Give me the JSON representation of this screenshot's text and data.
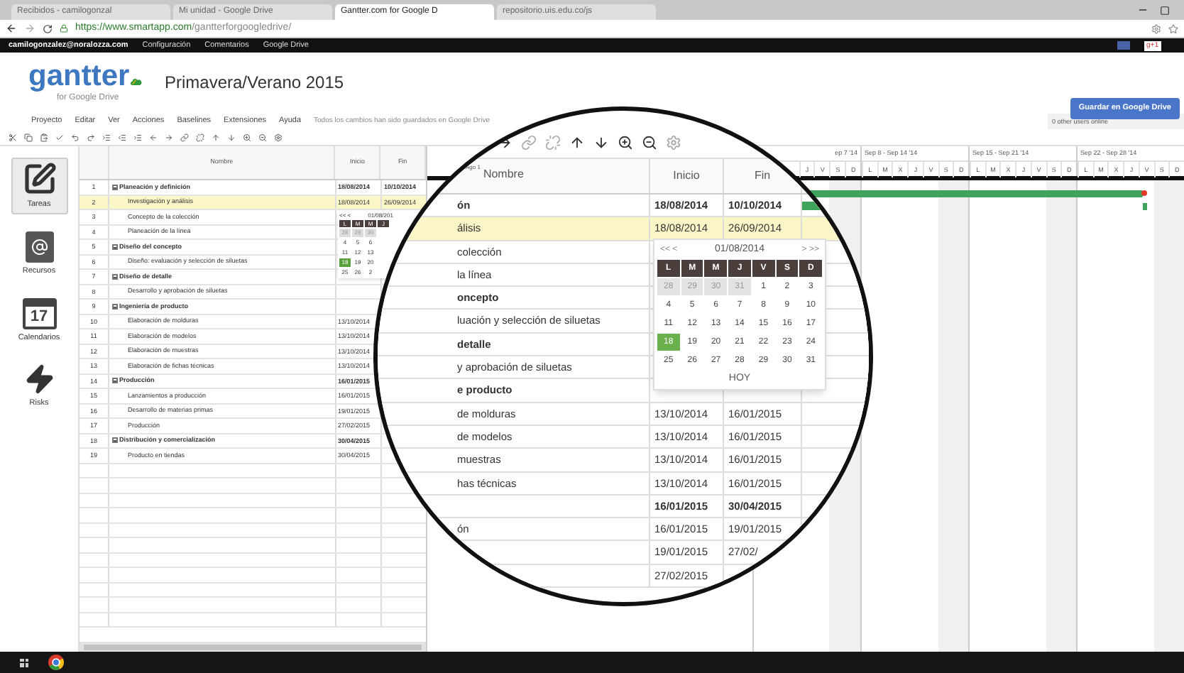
{
  "browser": {
    "tabs": [
      {
        "label": "Recibidos - camilogonzal",
        "selected": false
      },
      {
        "label": "Mi unidad - Google Drive",
        "selected": false
      },
      {
        "label": "Gantter.com for Google D",
        "selected": true
      },
      {
        "label": "repositorio.uis.edu.co/js",
        "selected": false
      }
    ],
    "url_host": "https://www.smartapp.com",
    "url_path": "/gantterforgoogledrive/"
  },
  "account_bar": {
    "email": "camilogonzalez@noralozza.com",
    "links": [
      "Configuración",
      "Comentarios",
      "Google Drive"
    ],
    "gplus": "g+1"
  },
  "app": {
    "logo": "gantter",
    "logo_sub": "for Google Drive",
    "title": "Primavera/Verano 2015",
    "save_button": "Guardar en Google Drive",
    "users_online": "0 other users online"
  },
  "menu": [
    "Proyecto",
    "Editar",
    "Ver",
    "Acciones",
    "Baselines",
    "Extensiones",
    "Ayuda"
  ],
  "status": "Todos los cambios han sido guardados en Google Drive",
  "sidebar": [
    {
      "label": "Tareas",
      "kind": "tasks",
      "selected": true
    },
    {
      "label": "Recursos",
      "kind": "resources",
      "selected": false
    },
    {
      "label": "Calendarios",
      "kind": "calendar",
      "badge": "17",
      "selected": false
    },
    {
      "label": "Risks",
      "kind": "risks",
      "selected": false
    }
  ],
  "table": {
    "columns": [
      "Nombre",
      "Inicio",
      "Fin"
    ],
    "rows": [
      {
        "num": "1",
        "name": "Planeación y definición",
        "kind": "group",
        "selected": false,
        "start": "18/08/2014",
        "end": "10/10/2014"
      },
      {
        "num": "2",
        "name": "Investigación y análisis",
        "kind": "task",
        "selected": true,
        "start": "18/08/2014",
        "end": "26/09/2014"
      },
      {
        "num": "3",
        "name": "Concepto de la colección",
        "kind": "task",
        "selected": false
      },
      {
        "num": "4",
        "name": "Planeación de la línea",
        "kind": "task",
        "selected": false
      },
      {
        "num": "5",
        "name": "Diseño del concepto",
        "kind": "group",
        "selected": false
      },
      {
        "num": "6",
        "name": "Diseño: evaluación y selección de siluetas",
        "kind": "task",
        "selected": false
      },
      {
        "num": "7",
        "name": "Diseño de detalle",
        "kind": "group",
        "selected": false
      },
      {
        "num": "8",
        "name": "Desarrollo y aprobación de siluetas",
        "kind": "task",
        "selected": false
      },
      {
        "num": "9",
        "name": "Ingeniería de producto",
        "kind": "group",
        "selected": false
      },
      {
        "num": "10",
        "name": "Elaboración de molduras",
        "kind": "task",
        "selected": false,
        "start": "13/10/2014"
      },
      {
        "num": "11",
        "name": "Elaboración de modelos",
        "kind": "task",
        "selected": false,
        "start": "13/10/2014"
      },
      {
        "num": "12",
        "name": "Elaboración de muestras",
        "kind": "task",
        "selected": false,
        "start": "13/10/2014"
      },
      {
        "num": "13",
        "name": "Elaboración de fichas técnicas",
        "kind": "task",
        "selected": false,
        "start": "13/10/2014"
      },
      {
        "num": "14",
        "name": "Producción",
        "kind": "group",
        "selected": false,
        "start": "16/01/2015"
      },
      {
        "num": "15",
        "name": "Lanzamientos a producción",
        "kind": "task",
        "selected": false,
        "start": "16/01/2015"
      },
      {
        "num": "16",
        "name": "Desarrollo de materias primas",
        "kind": "task",
        "selected": false,
        "start": "19/01/2015"
      },
      {
        "num": "17",
        "name": "Producción",
        "kind": "task",
        "selected": false,
        "start": "27/02/2015"
      },
      {
        "num": "18",
        "name": "Distribución y comercialización",
        "kind": "group",
        "selected": false,
        "start": "30/04/2015"
      },
      {
        "num": "19",
        "name": "Producto en tiendas",
        "kind": "task",
        "selected": false,
        "start": "30/04/2015"
      }
    ]
  },
  "mini_calendar": {
    "nav": "<< <",
    "month": "01/08/201",
    "weekdays": [
      "L",
      "M",
      "M",
      "J"
    ],
    "weeks": [
      [
        {
          "day": "28",
          "outside": true,
          "selected": false
        },
        {
          "day": "29",
          "outside": true,
          "selected": false
        },
        {
          "day": "30",
          "outside": true,
          "selected": false
        }
      ],
      [
        {
          "day": "4",
          "outside": false,
          "selected": false
        },
        {
          "day": "5",
          "outside": false,
          "selected": false
        },
        {
          "day": "6",
          "outside": false,
          "selected": false
        }
      ],
      [
        {
          "day": "11",
          "outside": false,
          "selected": false
        },
        {
          "day": "12",
          "outside": false,
          "selected": false
        },
        {
          "day": "13",
          "outside": false,
          "selected": false
        }
      ],
      [
        {
          "day": "18",
          "outside": false,
          "selected": true
        },
        {
          "day": "19",
          "outside": false,
          "selected": false
        },
        {
          "day": "20",
          "outside": false,
          "selected": false
        }
      ],
      [
        {
          "day": "25",
          "outside": false,
          "selected": false
        },
        {
          "day": "26",
          "outside": false,
          "selected": false
        },
        {
          "day": "2",
          "outside": false,
          "selected": false
        }
      ]
    ]
  },
  "gantt": {
    "weeks": [
      {
        "label": "ep 7 '14",
        "days": [
          "J",
          "V",
          "S",
          "D"
        ]
      },
      {
        "label": "Sep 8 - Sep 14 '14",
        "days": [
          "L",
          "M",
          "X",
          "J",
          "V",
          "S",
          "D"
        ]
      },
      {
        "label": "Sep 15 - Sep 21 '14",
        "days": [
          "L",
          "M",
          "X",
          "J",
          "V",
          "S",
          "D"
        ]
      },
      {
        "label": "Sep 22 - Sep 28 '14",
        "days": [
          "L",
          "M",
          "X",
          "J",
          "V",
          "S",
          "D"
        ]
      }
    ]
  },
  "magnifier": {
    "header_note": "Ago 1",
    "columns": [
      "Nombre",
      "Inicio",
      "Fin"
    ],
    "rows": [
      {
        "name": "ón",
        "kind": "group",
        "selected": false,
        "start": "18/08/2014",
        "end": "10/10/2014"
      },
      {
        "name": "álisis",
        "kind": "task",
        "selected": true,
        "start": "18/08/2014",
        "end": "26/09/2014"
      },
      {
        "name": "colección",
        "kind": "task",
        "selected": false
      },
      {
        "name": "la línea",
        "kind": "task",
        "selected": false
      },
      {
        "name": "oncepto",
        "kind": "group",
        "selected": false
      },
      {
        "name": "luación y selección de siluetas",
        "kind": "task",
        "selected": false
      },
      {
        "name": "detalle",
        "kind": "group",
        "selected": false
      },
      {
        "name": "y aprobación de siluetas",
        "kind": "task",
        "selected": false
      },
      {
        "name": "e producto",
        "kind": "group",
        "selected": false
      },
      {
        "name": "de molduras",
        "kind": "task",
        "selected": false,
        "start": "13/10/2014",
        "end": "16/01/2015"
      },
      {
        "name": "de modelos",
        "kind": "task",
        "selected": false,
        "start": "13/10/2014",
        "end": "16/01/2015"
      },
      {
        "name": "muestras",
        "kind": "task",
        "selected": false,
        "start": "13/10/2014",
        "end": "16/01/2015"
      },
      {
        "name": "has técnicas",
        "kind": "task",
        "selected": false,
        "start": "13/10/2014",
        "end": "16/01/2015"
      },
      {
        "kind": "group",
        "selected": false,
        "start": "16/01/2015",
        "end": "30/04/2015"
      },
      {
        "name": "ón",
        "kind": "task",
        "selected": false,
        "start": "16/01/2015",
        "end": "19/01/2015"
      },
      {
        "kind": "task",
        "selected": false,
        "start": "19/01/2015",
        "end": "27/02/"
      },
      {
        "kind": "task",
        "selected": false,
        "start": "27/02/2015"
      }
    ],
    "calendar": {
      "prev": "<< <",
      "month": "01/08/2014",
      "next": "> >>",
      "weekdays": [
        "L",
        "M",
        "M",
        "J",
        "V",
        "S",
        "D"
      ],
      "footer": "HOY",
      "weeks": [
        [
          {
            "day": "28",
            "outside": true,
            "selected": false
          },
          {
            "day": "29",
            "outside": true,
            "selected": false
          },
          {
            "day": "30",
            "outside": true,
            "selected": false
          },
          {
            "day": "31",
            "outside": true,
            "selected": false
          },
          {
            "day": "1",
            "outside": false,
            "selected": false
          },
          {
            "day": "2",
            "outside": false,
            "selected": false
          },
          {
            "day": "3",
            "outside": false,
            "selected": false
          }
        ],
        [
          {
            "day": "4",
            "outside": false,
            "selected": false
          },
          {
            "day": "5",
            "outside": false,
            "selected": false
          },
          {
            "day": "6",
            "outside": false,
            "selected": false
          },
          {
            "day": "7",
            "outside": false,
            "selected": false
          },
          {
            "day": "8",
            "outside": false,
            "selected": false
          },
          {
            "day": "9",
            "outside": false,
            "selected": false
          },
          {
            "day": "10",
            "outside": false,
            "selected": false
          }
        ],
        [
          {
            "day": "11",
            "outside": false,
            "selected": false
          },
          {
            "day": "12",
            "outside": false,
            "selected": false
          },
          {
            "day": "13",
            "outside": false,
            "selected": false
          },
          {
            "day": "14",
            "outside": false,
            "selected": false
          },
          {
            "day": "15",
            "outside": false,
            "selected": false
          },
          {
            "day": "16",
            "outside": false,
            "selected": false
          },
          {
            "day": "17",
            "outside": false,
            "selected": false
          }
        ],
        [
          {
            "day": "18",
            "outside": false,
            "selected": true
          },
          {
            "day": "19",
            "outside": false,
            "selected": false
          },
          {
            "day": "20",
            "outside": false,
            "selected": false
          },
          {
            "day": "21",
            "outside": false,
            "selected": false
          },
          {
            "day": "22",
            "outside": false,
            "selected": false
          },
          {
            "day": "23",
            "outside": false,
            "selected": false
          },
          {
            "day": "24",
            "outside": false,
            "selected": false
          }
        ],
        [
          {
            "day": "25",
            "outside": false,
            "selected": false
          },
          {
            "day": "26",
            "outside": false,
            "selected": false
          },
          {
            "day": "27",
            "outside": false,
            "selected": false
          },
          {
            "day": "28",
            "outside": false,
            "selected": false
          },
          {
            "day": "29",
            "outside": false,
            "selected": false
          },
          {
            "day": "30",
            "outside": false,
            "selected": false
          },
          {
            "day": "31",
            "outside": false,
            "selected": false
          }
        ]
      ]
    }
  }
}
